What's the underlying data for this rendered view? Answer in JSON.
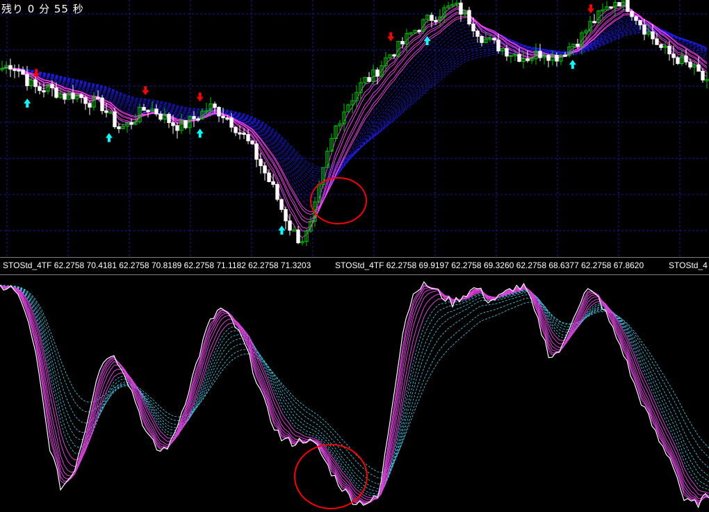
{
  "timer": {
    "text": "残り 0 分 55 秒"
  },
  "indicator_labels": [
    "STOStd_4TF 62.2758 70.4181 62.2758 70.8189 62.2758 71.1182 62.2758 71.3203",
    "STOStd_4TF 62.2758 69.9197 62.2758 69.3260 62.2758 68.6377 62.2758 67.8620",
    "STOStd_4"
  ],
  "colors": {
    "background": "#000000",
    "grid": "#1a1aa0",
    "bull_candle": "#00c800",
    "bear_candle": "#ffffff",
    "fast_ma": "#ff40ff",
    "slow_ma": "#2020ff",
    "buy_arrow": "#00ffff",
    "sell_arrow": "#ff0000",
    "stoch_main": "#ffffff",
    "stoch_fast": "#e040e0",
    "stoch_slow": "#40c0e0",
    "highlight_circle": "#ff0000"
  },
  "chart_data": [
    {
      "type": "candlestick",
      "title": "",
      "grid": true,
      "price_path": [
        0.78,
        0.8,
        0.77,
        0.71,
        0.68,
        0.69,
        0.67,
        0.65,
        0.66,
        0.64,
        0.62,
        0.61,
        0.55,
        0.5,
        0.52,
        0.56,
        0.6,
        0.58,
        0.55,
        0.52,
        0.51,
        0.54,
        0.57,
        0.6,
        0.58,
        0.55,
        0.5,
        0.45,
        0.38,
        0.3,
        0.22,
        0.12,
        0.03,
        -0.02,
        0.02,
        0.2,
        0.38,
        0.52,
        0.6,
        0.66,
        0.72,
        0.74,
        0.8,
        0.85,
        0.88,
        0.93,
        0.97,
        1.0,
        1.03,
        1.05,
        1.07,
        1.04,
        0.99,
        0.93,
        0.9,
        0.88,
        0.86,
        0.84,
        0.83,
        0.84,
        0.86,
        0.83,
        0.85,
        0.89,
        0.92,
        0.98,
        1.02,
        1.06,
        1.1,
        1.08,
        1.03,
        0.97,
        0.92,
        0.87,
        0.84,
        0.82,
        0.79,
        0.76,
        0.7
      ],
      "buy_signals": [
        3,
        12,
        22,
        31,
        47,
        63
      ],
      "sell_signals": [
        4,
        16,
        22,
        43,
        65
      ]
    },
    {
      "type": "line",
      "title": "",
      "grid": false,
      "main_line": [
        97,
        97,
        88,
        65,
        28,
        8,
        15,
        35,
        60,
        68,
        62,
        48,
        32,
        24,
        28,
        44,
        62,
        80,
        88,
        82,
        72,
        56,
        40,
        30,
        28,
        30,
        26,
        16,
        8,
        2,
        2,
        4,
        42,
        80,
        97,
        98,
        94,
        90,
        94,
        97,
        91,
        93,
        97,
        97,
        82,
        66,
        70,
        86,
        96,
        92,
        80,
        68,
        52,
        40,
        28,
        20,
        2,
        1,
        5
      ],
      "ylim": [
        0,
        100
      ]
    }
  ]
}
